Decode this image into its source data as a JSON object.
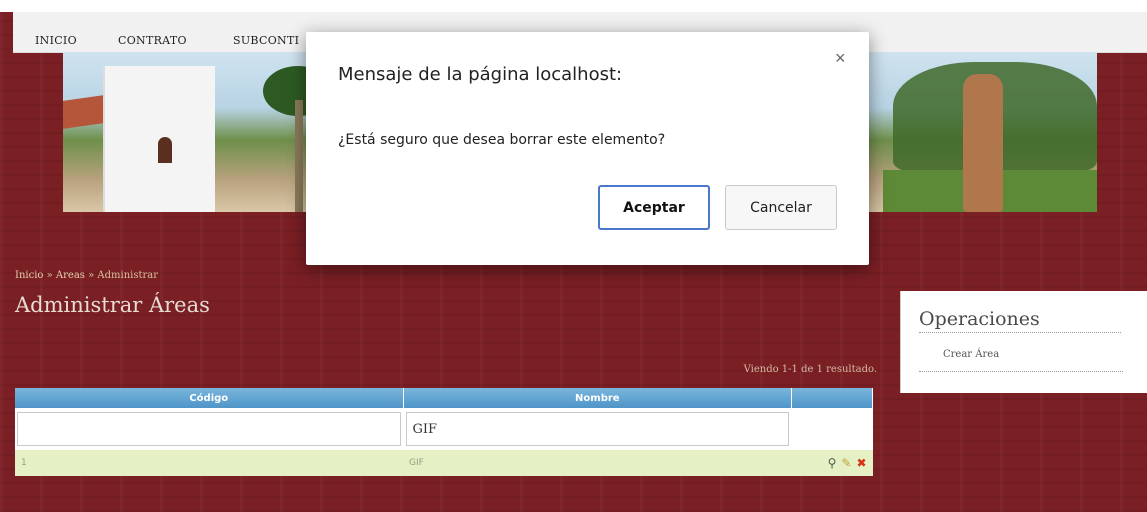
{
  "menu": {
    "items": [
      "INICIO",
      "CONTRATO",
      "SUBCONTI"
    ]
  },
  "breadcrumb": {
    "home": "Inicio",
    "section": "Areas",
    "current": "Administrar",
    "separator": " » "
  },
  "page": {
    "title": "Administrar Áreas",
    "summary": "Viendo 1-1 de 1 resultado."
  },
  "grid": {
    "columns": [
      "Código",
      "Nombre",
      ""
    ],
    "filters": {
      "codigo": "",
      "nombre": "GIF"
    },
    "rows": [
      {
        "codigo": "1",
        "nombre": "GIF"
      }
    ],
    "actions": {
      "view": "⚲",
      "edit": "✎",
      "delete": "✖"
    }
  },
  "sidebar": {
    "title": "Operaciones",
    "items": [
      "Crear Área"
    ]
  },
  "dialog": {
    "title": "Mensaje de la página localhost:",
    "close": "×",
    "message": "¿Está seguro que desea borrar este elemento?",
    "ok": "Aceptar",
    "cancel": "Cancelar"
  },
  "colors": {
    "background": "#7a1f24",
    "grid_header": "#4f95c8",
    "row_bg": "#e5f1c4",
    "delete": "#d53316",
    "dialog_accent": "#4a78c9"
  }
}
